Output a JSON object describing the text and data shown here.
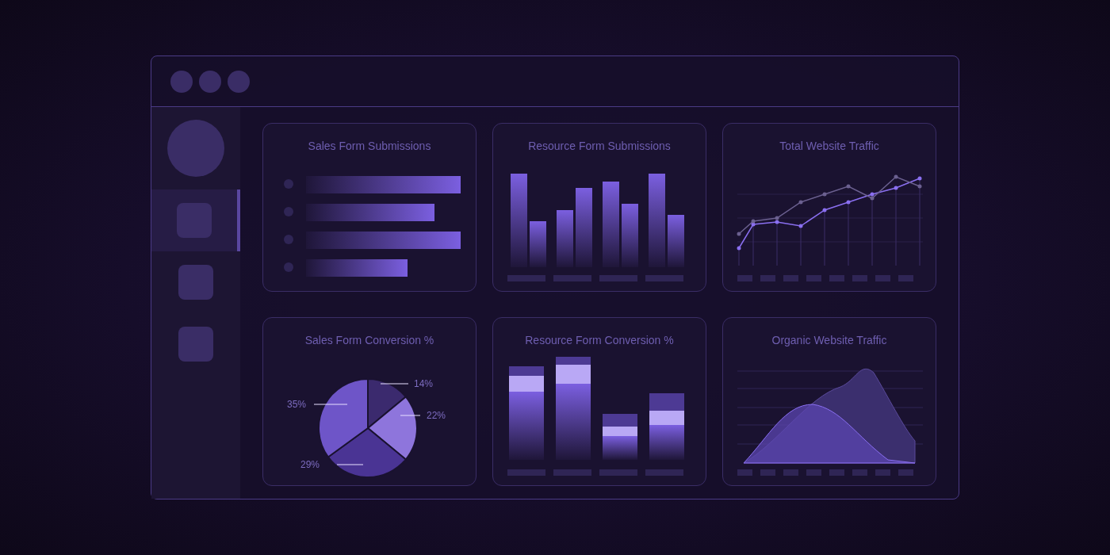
{
  "sidebar": {
    "items": [
      {
        "selected": true
      },
      {
        "selected": false
      },
      {
        "selected": false
      }
    ]
  },
  "cards": [
    {
      "title": "Sales Form Submissions",
      "kind": "hbar"
    },
    {
      "title": "Resource Form Submissions",
      "kind": "bars"
    },
    {
      "title": "Total Website Traffic",
      "kind": "line"
    },
    {
      "title": "Sales Form Conversion %",
      "kind": "pie",
      "chart_data": {
        "type": "pie",
        "values": [
          14,
          22,
          29,
          35
        ],
        "value_labels": [
          "14%",
          "22%",
          "29%",
          "35%"
        ]
      }
    },
    {
      "title": "Resource Form Conversion %",
      "kind": "stacked"
    },
    {
      "title": "Organic Website Traffic",
      "kind": "area"
    }
  ]
}
